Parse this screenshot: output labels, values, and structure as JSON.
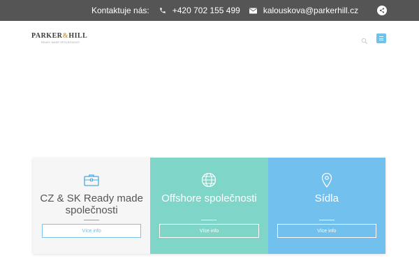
{
  "topbar": {
    "contact_label": "Kontaktuje nás:",
    "phone": "+420 702 155 499",
    "email": "kalouskova@parkerhill.cz",
    "icons": [
      "phone-icon",
      "envelope-icon",
      "share-icon"
    ]
  },
  "header": {
    "logo": {
      "name_left": "PARKER",
      "ampersand": "&",
      "name_right": "HILL",
      "tagline": "READY MADE SPOLEČNOSTI"
    },
    "icons": [
      "search-icon",
      "menu-icon"
    ]
  },
  "services": [
    {
      "icon": "briefcase-icon",
      "title": "CZ & SK Ready made společnosti",
      "button": "Více info"
    },
    {
      "icon": "globe-icon",
      "title": "Offshore společnosti",
      "button": "Více info"
    },
    {
      "icon": "map-pin-icon",
      "title": "Sídla",
      "button": "Více info"
    }
  ],
  "colors": {
    "topbar": "#555555",
    "card_1": "#f6f6f7",
    "card_2": "#7fd5c8",
    "card_3": "#72c0ee",
    "accent": "#6ec3ea"
  }
}
